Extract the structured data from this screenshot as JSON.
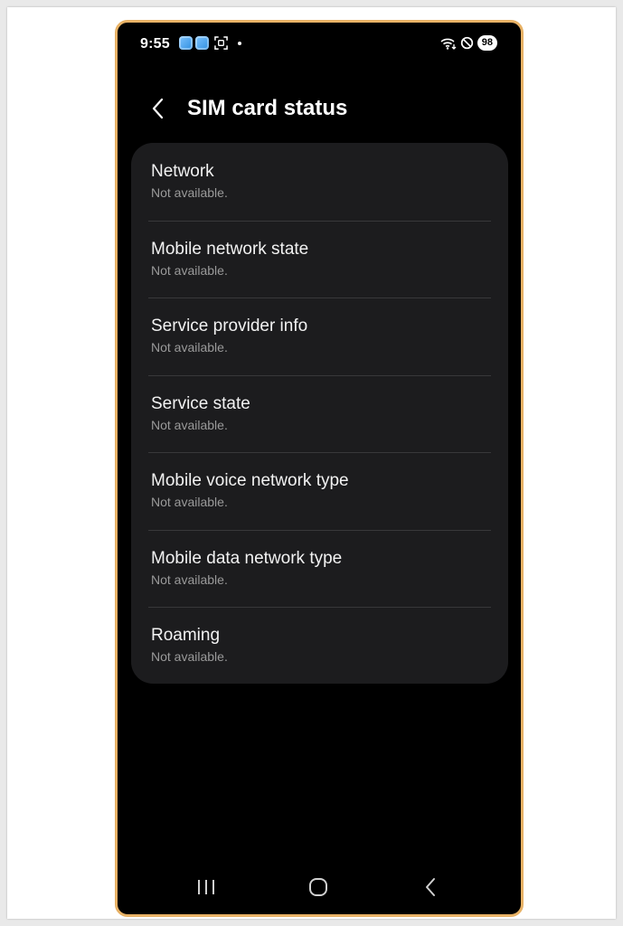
{
  "status_bar": {
    "time": "9:55",
    "battery": "98",
    "notification_icons": [
      "app-icon",
      "app-icon",
      "screenshot-icon",
      "dot"
    ],
    "system_icons": [
      "wifi-icon",
      "do-not-disturb-icon",
      "battery-icon"
    ]
  },
  "header": {
    "title": "SIM card status",
    "back_icon": "chevron-left-icon"
  },
  "items": [
    {
      "title": "Network",
      "value": "Not available."
    },
    {
      "title": "Mobile network state",
      "value": "Not available."
    },
    {
      "title": "Service provider info",
      "value": "Not available."
    },
    {
      "title": "Service state",
      "value": "Not available."
    },
    {
      "title": "Mobile voice network type",
      "value": "Not available."
    },
    {
      "title": "Mobile data network type",
      "value": "Not available."
    },
    {
      "title": "Roaming",
      "value": "Not available."
    }
  ],
  "nav_bar": {
    "buttons": [
      "recents-icon",
      "home-icon",
      "back-icon"
    ]
  },
  "colors": {
    "frame": "#e8b266",
    "background": "#000000",
    "card": "#1c1c1e",
    "divider": "#38383a",
    "primary_text": "#f2f2f2",
    "secondary_text": "#9a9a9a"
  }
}
